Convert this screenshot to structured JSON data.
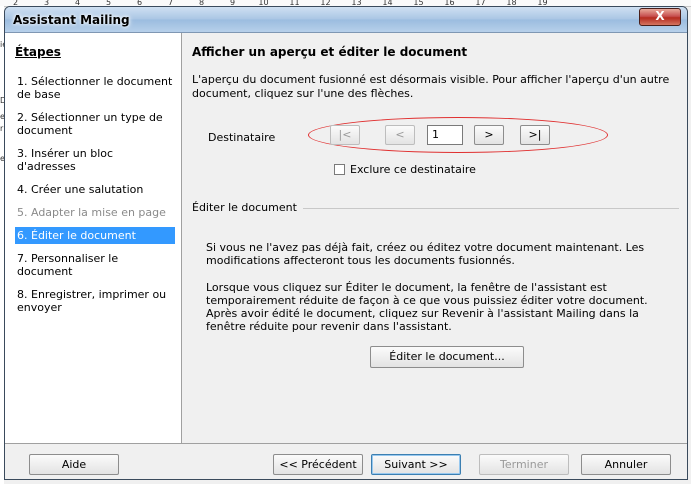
{
  "ruler": {
    "marks": [
      "2",
      "3",
      "4",
      "5",
      "6",
      "7",
      "8",
      "9",
      "10",
      "11",
      "12",
      "13",
      "14",
      "15",
      "16",
      "17",
      "18",
      "19"
    ]
  },
  "background_left": {
    "chars": [
      "ie",
      "D",
      "e",
      "r",
      "e"
    ]
  },
  "window": {
    "title": "Assistant Mailing",
    "close_glyph": "X"
  },
  "sidebar": {
    "title": "Étapes",
    "steps": [
      {
        "label": "1. Sélectionner le document de base",
        "state": "normal"
      },
      {
        "label": "2. Sélectionner un type de document",
        "state": "normal"
      },
      {
        "label": "3. Insérer un bloc d'adresses",
        "state": "normal"
      },
      {
        "label": "4. Créer une salutation",
        "state": "normal"
      },
      {
        "label": "5. Adapter la mise en page",
        "state": "disabled"
      },
      {
        "label": "6. Éditer le document",
        "state": "active"
      },
      {
        "label": "7. Personnaliser le document",
        "state": "normal"
      },
      {
        "label": "8. Enregistrer, imprimer ou envoyer",
        "state": "normal"
      }
    ]
  },
  "main": {
    "heading": "Afficher un aperçu et éditer le document",
    "intro": "L'aperçu du document fusionné est désormais visible. Pour afficher l'aperçu d'un autre document, cliquez sur l'une des flèches.",
    "recipient_label": "Destinataire",
    "nav": {
      "first": "|<",
      "prev": "<",
      "current": "1",
      "next": ">",
      "last": ">|"
    },
    "exclude_label": "Exclure ce destinataire",
    "section_title": "Éditer le document",
    "para1": "Si vous ne l'avez pas déjà fait, créez ou éditez votre document maintenant. Les modifications affecteront tous les documents fusionnés.",
    "para2": "Lorsque vous cliquez sur Éditer le document, la fenêtre de l'assistant est temporairement réduite de façon à ce que vous puissiez éditer votre document. Après avoir édité le document, cliquez sur Revenir à l'assistant Mailing dans la fenêtre réduite pour revenir dans l'assistant.",
    "edit_button": "Éditer le document..."
  },
  "footer": {
    "help": "Aide",
    "previous": "<< Précédent",
    "next": "Suivant >>",
    "finish": "Terminer",
    "cancel": "Annuler"
  },
  "colors": {
    "highlight": "#3399ff",
    "annotation": "#e03030"
  }
}
